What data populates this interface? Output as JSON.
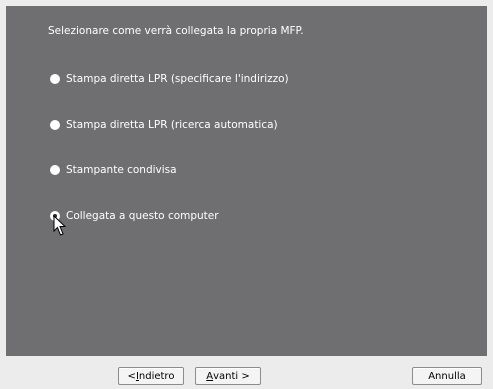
{
  "prompt": "Selezionare come verrà collegata la propria MFP.",
  "options": [
    {
      "label": "Stampa diretta LPR (specificare l'indirizzo)",
      "checked": false
    },
    {
      "label": "Stampa diretta LPR (ricerca automatica)",
      "checked": false
    },
    {
      "label": "Stampante condivisa",
      "checked": false
    },
    {
      "label": "Collegata a questo computer",
      "checked": true
    }
  ],
  "buttons": {
    "back_prefix": "< ",
    "back_accel": "I",
    "back_rest": "ndietro",
    "next_accel": "A",
    "next_rest": "vanti >",
    "cancel": "Annulla"
  },
  "colors": {
    "panel": "#6f6f71",
    "text": "#ffffff",
    "footer": "#ececec"
  }
}
